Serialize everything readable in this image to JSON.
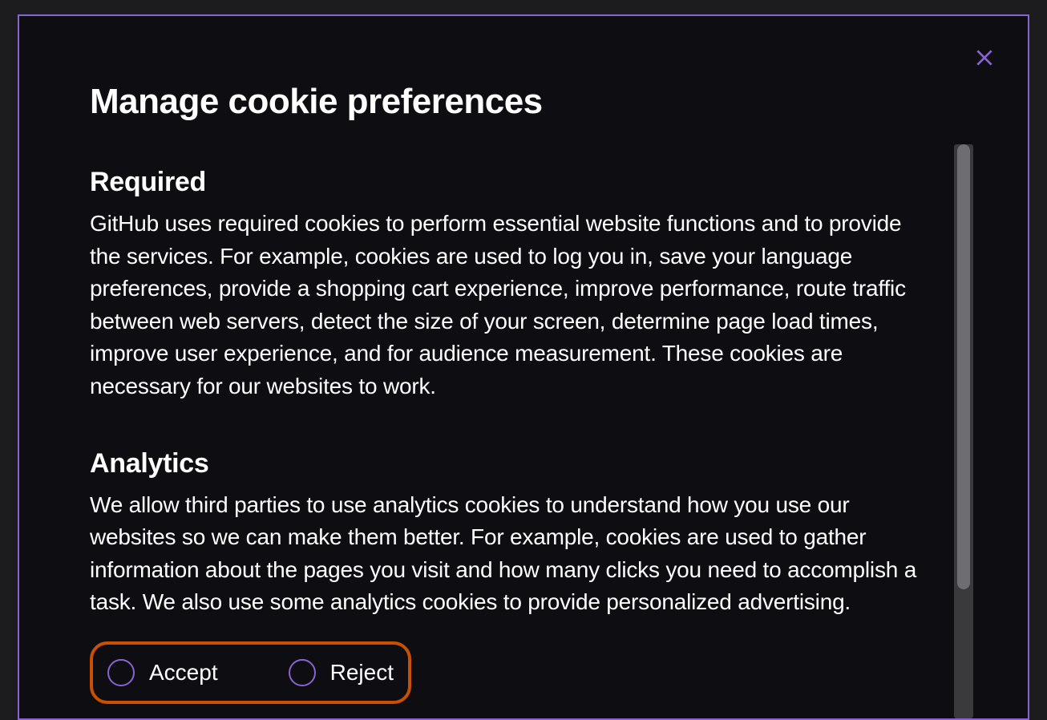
{
  "modal": {
    "title": "Manage cookie preferences",
    "sections": [
      {
        "heading": "Required",
        "description": "GitHub uses required cookies to perform essential website functions and to provide the services. For example, cookies are used to log you in, save your language preferences, provide a shopping cart experience, improve performance, route traffic between web servers, detect the size of your screen, determine page load times, improve user experience, and for audience measurement. These cookies are necessary for our websites to work."
      },
      {
        "heading": "Analytics",
        "description": "We allow third parties to use analytics cookies to understand how you use our websites so we can make them better. For example, cookies are used to gather information about the pages you visit and how many clicks you need to accomplish a task. We also use some analytics cookies to provide personalized advertising."
      }
    ],
    "radio_options": {
      "accept": "Accept",
      "reject": "Reject"
    }
  },
  "colors": {
    "accent": "#8a63d2",
    "highlight_border": "#c75100",
    "background": "#0d0d12"
  }
}
